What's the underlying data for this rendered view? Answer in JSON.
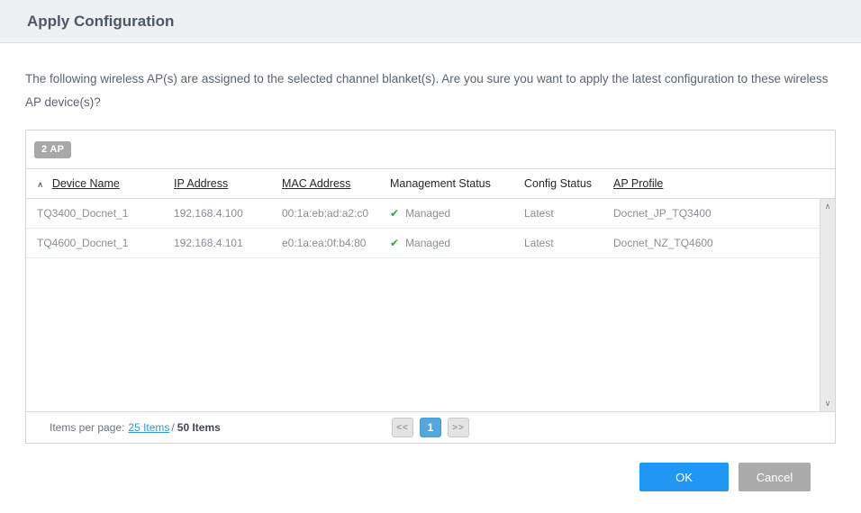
{
  "dialog": {
    "title": "Apply Configuration",
    "message": "The following wireless AP(s) are assigned to the selected channel blanket(s). Are you sure you want to apply the latest configuration to these wireless AP device(s)?",
    "count_badge": "2 AP",
    "ok_label": "OK",
    "cancel_label": "Cancel"
  },
  "table": {
    "columns": [
      {
        "label": "Device Name",
        "sortable": true,
        "sorted": "asc"
      },
      {
        "label": "IP Address",
        "sortable": true
      },
      {
        "label": "MAC Address",
        "sortable": true
      },
      {
        "label": "Management Status",
        "sortable": false
      },
      {
        "label": "Config Status",
        "sortable": false
      },
      {
        "label": "AP Profile",
        "sortable": true
      }
    ],
    "rows": [
      {
        "device_name": "TQ3400_Docnet_1",
        "ip_address": "192.168.4.100",
        "mac_address": "00:1a:eb:ad:a2:c0",
        "management_status": "Managed",
        "config_status": "Latest",
        "ap_profile": "Docnet_JP_TQ3400"
      },
      {
        "device_name": "TQ4600_Docnet_1",
        "ip_address": "192.168.4.101",
        "mac_address": "e0:1a:ea:0f:b4:80",
        "management_status": "Managed",
        "config_status": "Latest",
        "ap_profile": "Docnet_NZ_TQ4600"
      }
    ]
  },
  "pagination": {
    "items_per_page_label": "Items per page:",
    "items_per_page_value": "25 Items",
    "separator": "/",
    "total_items": "50 Items",
    "prev_label": "<<",
    "current_page": "1",
    "next_label": ">>"
  },
  "icons": {
    "sort_asc": "∧",
    "managed_check": "✔",
    "scroll_up": "∧",
    "scroll_down": "∨"
  },
  "colors": {
    "accent_blue": "#2196f3",
    "page_blue": "#53a7dc",
    "success_green": "#35a33a",
    "link_blue": "#2e9bd6",
    "badge_gray": "#a8a8a8",
    "cancel_gray": "#ababab"
  }
}
